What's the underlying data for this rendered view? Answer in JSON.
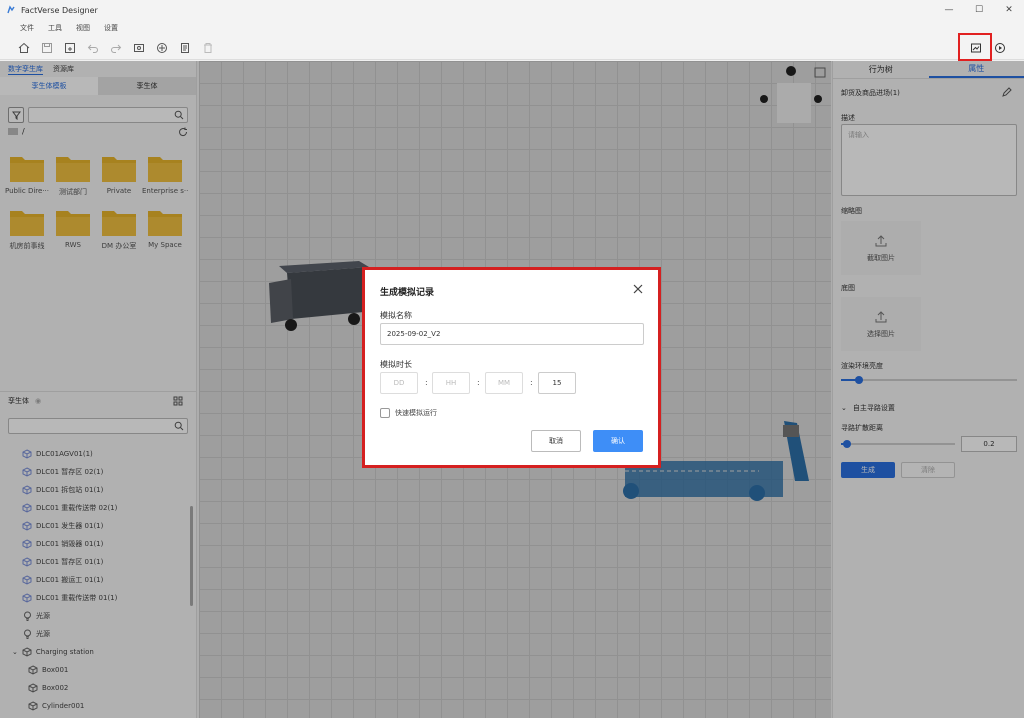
{
  "window": {
    "title": "FactVerse Designer",
    "controls": [
      "—",
      "☐",
      "✕"
    ]
  },
  "menu": [
    "文件",
    "工具",
    "视图",
    "设置"
  ],
  "toolbar": {
    "icons": [
      "home-icon",
      "save-icon",
      "save-as-icon",
      "undo-icon",
      "redo-icon",
      "import-icon",
      "publish-icon",
      "export-icon",
      "delete-icon"
    ],
    "right_icons": [
      "simulation-record-icon",
      "run-icon"
    ]
  },
  "left_panel": {
    "tabs": [
      "数字孪生库",
      "资源库"
    ],
    "subtabs": [
      "孪生体模板",
      "孪生体"
    ],
    "path": "/",
    "folders": [
      "Public Dire···",
      "测试部门",
      "Private",
      "Enterprise s···",
      "机房前事线",
      "RWS",
      "DM 办公室",
      "My Space"
    ],
    "twin_section": "孪生体",
    "tree": [
      {
        "label": "DLC01AGV01(1)",
        "icon": "cube-icon",
        "indent": 1
      },
      {
        "label": "DLC01 暂存区 02(1)",
        "icon": "cube-icon",
        "indent": 1
      },
      {
        "label": "DLC01 拆包站 01(1)",
        "icon": "cube-icon",
        "indent": 1
      },
      {
        "label": "DLC01 重载传送带 02(1)",
        "icon": "cube-icon",
        "indent": 1
      },
      {
        "label": "DLC01 发生器 01(1)",
        "icon": "cube-icon",
        "indent": 1
      },
      {
        "label": "DLC01 销毁器 01(1)",
        "icon": "cube-icon",
        "indent": 1
      },
      {
        "label": "DLC01 暂存区 01(1)",
        "icon": "cube-icon",
        "indent": 1
      },
      {
        "label": "DLC01 搬运工 01(1)",
        "icon": "cube-icon",
        "indent": 1
      },
      {
        "label": "DLC01 重载传送带 01(1)",
        "icon": "cube-icon",
        "indent": 1
      },
      {
        "label": "光源",
        "icon": "bulb-icon",
        "indent": 1
      },
      {
        "label": "光源",
        "icon": "bulb-icon",
        "indent": 1
      },
      {
        "label": "Charging station",
        "icon": "cube-icon",
        "indent": 0
      },
      {
        "label": "Box001",
        "icon": "cube-icon",
        "indent": 2
      },
      {
        "label": "Box002",
        "icon": "cube-icon",
        "indent": 2
      },
      {
        "label": "Cylinder001",
        "icon": "cube-icon",
        "indent": 2
      }
    ]
  },
  "right_panel": {
    "tabs": [
      "行为树",
      "属性"
    ],
    "object_name": "卸货及商品进场(1)",
    "description_label": "描述",
    "description_placeholder": "请输入",
    "thumbnail_label": "缩略图",
    "thumbnail_button": "截取图片",
    "base_image_label": "底图",
    "base_image_button": "选择图片",
    "env_brightness_label": "渲染环境亮度",
    "env_brightness": 0.1,
    "pathfinding_section": "自主寻路设置",
    "expand_distance_label": "寻路扩散距离",
    "expand_distance": "0.2",
    "expand_distance_level": 0.05,
    "generate_button": "生成",
    "clear_button": "清除"
  },
  "dialog": {
    "title": "生成模拟记录",
    "name_label": "模拟名称",
    "name_value": "2025-09-02_V2",
    "duration_label": "模拟时长",
    "dd_placeholder": "DD",
    "hh_placeholder": "HH",
    "mm_placeholder": "MM",
    "ss_value": "15",
    "fast_run_label": "快速模拟运行",
    "cancel": "取消",
    "confirm": "确认"
  },
  "colors": {
    "accent": "#2a6fe0",
    "primary_button": "#3e8ef7",
    "highlight": "#d52020",
    "folder": "#e8b52c"
  }
}
